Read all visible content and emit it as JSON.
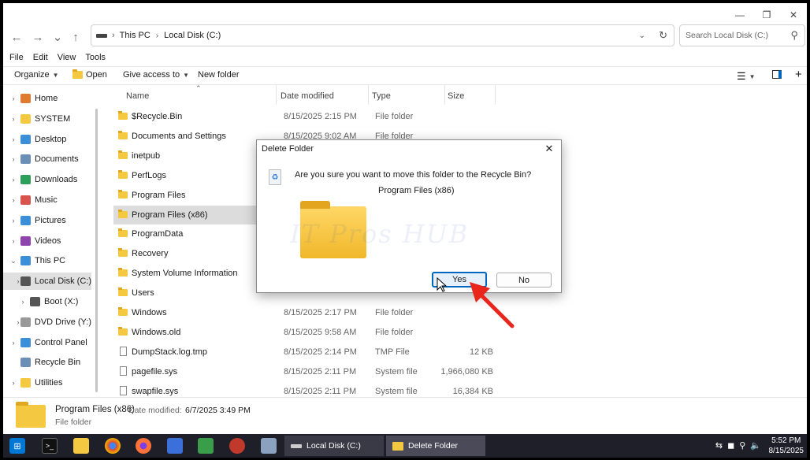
{
  "window": {
    "min": "—",
    "max": "❐",
    "close": "✕"
  },
  "address": {
    "back": "←",
    "forward": "→",
    "recent": "⌄",
    "up": "↑",
    "crumbs": [
      "This PC",
      "Local Disk (C:)"
    ],
    "separator": "›",
    "search_placeholder": "Search Local Disk (C:)"
  },
  "menu": [
    "File",
    "Edit",
    "View",
    "Tools"
  ],
  "toolbar": {
    "organize": "Organize",
    "open": "Open",
    "give_access": "Give access to",
    "new_folder": "New folder"
  },
  "sidebar": [
    {
      "label": "Home",
      "indent": 0,
      "arrow": "›",
      "color": "#e07a2e"
    },
    {
      "label": "SYSTEM",
      "indent": 0,
      "arrow": "›",
      "color": "#f5c842"
    },
    {
      "label": "Desktop",
      "indent": 0,
      "arrow": "›",
      "color": "#3b8fd9"
    },
    {
      "label": "Documents",
      "indent": 0,
      "arrow": "›",
      "color": "#6b8fb5"
    },
    {
      "label": "Downloads",
      "indent": 0,
      "arrow": "›",
      "color": "#2e9e5b"
    },
    {
      "label": "Music",
      "indent": 0,
      "arrow": "›",
      "color": "#d9534f"
    },
    {
      "label": "Pictures",
      "indent": 0,
      "arrow": "›",
      "color": "#3b8fd9"
    },
    {
      "label": "Videos",
      "indent": 0,
      "arrow": "›",
      "color": "#8e44ad"
    },
    {
      "label": "This PC",
      "indent": 0,
      "arrow": "⌄",
      "color": "#3b8fd9"
    },
    {
      "label": "Local Disk (C:)",
      "indent": 1,
      "arrow": "›",
      "color": "#555555"
    },
    {
      "label": "Boot (X:)",
      "indent": 1,
      "arrow": "›",
      "color": "#555555"
    },
    {
      "label": "DVD Drive (Y:)",
      "indent": 1,
      "arrow": "›",
      "color": "#999999"
    },
    {
      "label": "Control Panel",
      "indent": 0,
      "arrow": "›",
      "color": "#3b8fd9"
    },
    {
      "label": "Recycle Bin",
      "indent": 0,
      "arrow": "",
      "color": "#6b8fb5"
    },
    {
      "label": "Utilities",
      "indent": 0,
      "arrow": "›",
      "color": "#f5c842"
    }
  ],
  "columns": {
    "name": "Name",
    "date": "Date modified",
    "type": "Type",
    "size": "Size"
  },
  "files": [
    {
      "name": "$Recycle.Bin",
      "date": "8/15/2025 2:15 PM",
      "type": "File folder",
      "size": "",
      "kind": "folder"
    },
    {
      "name": "Documents and Settings",
      "date": "8/15/2025 9:02 AM",
      "type": "File folder",
      "size": "",
      "kind": "folder"
    },
    {
      "name": "inetpub",
      "date": "",
      "type": "",
      "size": "",
      "kind": "folder"
    },
    {
      "name": "PerfLogs",
      "date": "",
      "type": "",
      "size": "",
      "kind": "folder"
    },
    {
      "name": "Program Files",
      "date": "",
      "type": "",
      "size": "",
      "kind": "folder"
    },
    {
      "name": "Program Files (x86)",
      "date": "",
      "type": "",
      "size": "",
      "kind": "folder"
    },
    {
      "name": "ProgramData",
      "date": "",
      "type": "",
      "size": "",
      "kind": "folder"
    },
    {
      "name": "Recovery",
      "date": "",
      "type": "",
      "size": "",
      "kind": "folder"
    },
    {
      "name": "System Volume Information",
      "date": "",
      "type": "",
      "size": "",
      "kind": "folder"
    },
    {
      "name": "Users",
      "date": "",
      "type": "",
      "size": "",
      "kind": "folder"
    },
    {
      "name": "Windows",
      "date": "8/15/2025 2:17 PM",
      "type": "File folder",
      "size": "",
      "kind": "folder"
    },
    {
      "name": "Windows.old",
      "date": "8/15/2025 9:58 AM",
      "type": "File folder",
      "size": "",
      "kind": "folder"
    },
    {
      "name": "DumpStack.log.tmp",
      "date": "8/15/2025 2:14 PM",
      "type": "TMP File",
      "size": "12 KB",
      "kind": "file"
    },
    {
      "name": "pagefile.sys",
      "date": "8/15/2025 2:11 PM",
      "type": "System file",
      "size": "1,966,080 KB",
      "kind": "file"
    },
    {
      "name": "swapfile.sys",
      "date": "8/15/2025 2:11 PM",
      "type": "System file",
      "size": "16,384 KB",
      "kind": "file"
    }
  ],
  "details": {
    "name": "Program Files (x86)",
    "date_label": "Date modified:",
    "date_value": "6/7/2025 3:49 PM",
    "type": "File folder"
  },
  "dialog": {
    "title": "Delete Folder",
    "question": "Are you sure you want to move this folder to the Recycle Bin?",
    "item": "Program Files (x86)",
    "yes": "Yes",
    "no": "No",
    "watermark": "IT Pros HUB"
  },
  "taskbar": {
    "tasks": [
      "Local Disk (C:)",
      "Delete Folder"
    ],
    "time": "5:52 PM",
    "date": "8/15/2025"
  }
}
